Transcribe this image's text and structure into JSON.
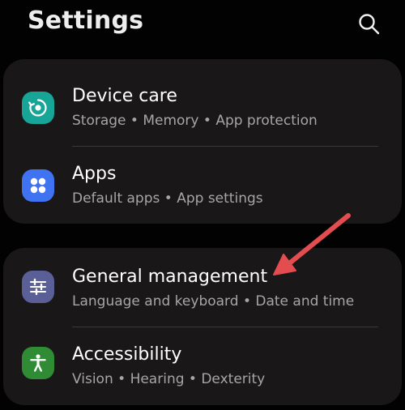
{
  "header": {
    "title": "Settings",
    "search_icon": "search-icon"
  },
  "colors": {
    "background": "#020202",
    "card": "#191718",
    "subtitle": "#a7a5a6",
    "device_care_icon": "#16a597",
    "apps_icon": "#3f73f2",
    "general_management_icon": "#5a5f98",
    "accessibility_icon": "#2f8c34",
    "annotation_arrow": "#e34d4f"
  },
  "groups": [
    {
      "items": [
        {
          "title": "Device care",
          "subtitle": "Storage  •  Memory  •  App protection",
          "icon": "device-care-icon"
        },
        {
          "title": "Apps",
          "subtitle": "Default apps  •  App settings",
          "icon": "apps-grid-icon"
        }
      ]
    },
    {
      "items": [
        {
          "title": "General management",
          "subtitle": "Language and keyboard  •  Date and time",
          "icon": "sliders-icon"
        },
        {
          "title": "Accessibility",
          "subtitle": "Vision  •  Hearing  •  Dexterity",
          "icon": "accessibility-icon"
        }
      ]
    }
  ],
  "annotation": {
    "type": "arrow",
    "points_to": "General management"
  }
}
